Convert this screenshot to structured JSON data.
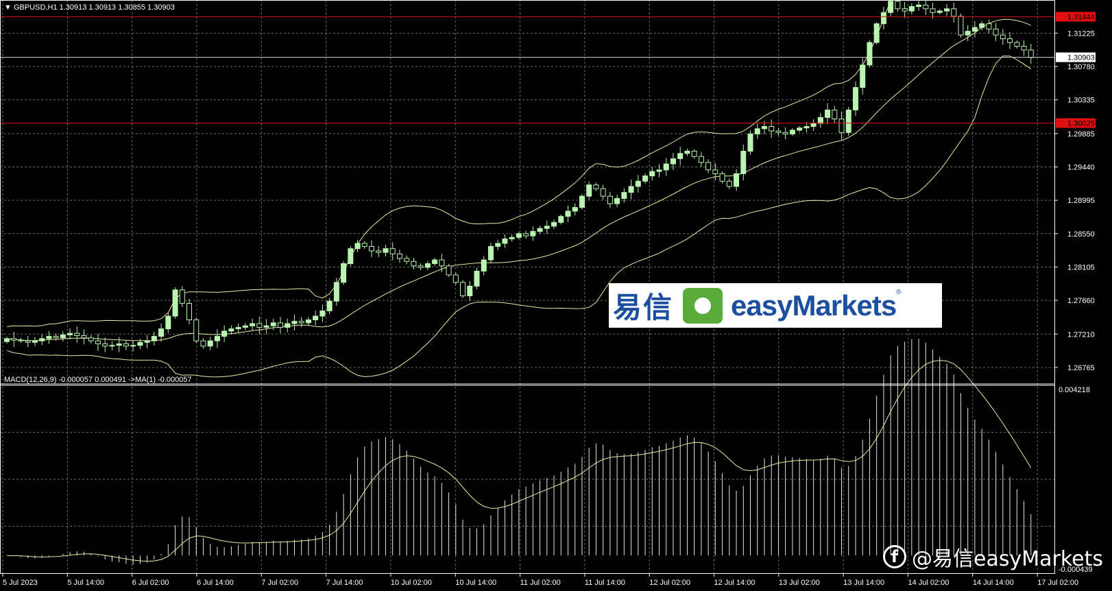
{
  "header": {
    "symbol": "GBPUSD,H1",
    "ohlc": "1.30913 1.30913 1.30855 1.30903",
    "dropdown_icon": "triangle-down-icon"
  },
  "macd_header": "MACD(12,26,9) -0.000057 0.000491  ->MA(1) -0.000057",
  "price_axis": {
    "min": 1.26545,
    "max": 1.31667,
    "ticks": [
      "1.31225",
      "1.30780",
      "1.30335",
      "1.29885",
      "1.29440",
      "1.28995",
      "1.28550",
      "1.28105",
      "1.27660",
      "1.27210",
      "1.26765"
    ],
    "current_price": "1.30903",
    "level_high": "1.31444",
    "level_low": "1.30025"
  },
  "macd_axis": {
    "min": -0.000439,
    "max": 0.004218,
    "top_label": "0.004218",
    "bottom_label": "-0.000439"
  },
  "time_axis": {
    "labels": [
      "5 Jul 2023",
      "5 Jul 14:00",
      "6 Jul 02:00",
      "6 Jul 14:00",
      "7 Jul 02:00",
      "7 Jul 14:00",
      "10 Jul 02:00",
      "10 Jul 14:00",
      "11 Jul 02:00",
      "11 Jul 14:00",
      "12 Jul 02:00",
      "12 Jul 14:00",
      "13 Jul 02:00",
      "13 Jul 14:00",
      "14 Jul 02:00",
      "14 Jul 14:00",
      "17 Jul 02:00"
    ]
  },
  "colors": {
    "background": "#000000",
    "grid": "#6e6e6e",
    "candle": "#b9f5b0",
    "band": "#ecec9e",
    "level_line": "#e01010",
    "macd_bar": "#e8e8e8",
    "signal": "#ecec9e",
    "logo_blue": "#1c4fa0",
    "logo_green": "#5aac3a"
  },
  "chart_data": {
    "type": "candlestick",
    "symbol": "GBPUSD",
    "timeframe": "H1",
    "closes_approx": [
      1.2715,
      1.2713,
      1.2712,
      1.271,
      1.2712,
      1.2715,
      1.2718,
      1.2716,
      1.272,
      1.2722,
      1.2719,
      1.2716,
      1.2712,
      1.2708,
      1.2705,
      1.2706,
      1.2708,
      1.2705,
      1.2706,
      1.271,
      1.2712,
      1.2718,
      1.2728,
      1.2745,
      1.278,
      1.2762,
      1.274,
      1.2712,
      1.2705,
      1.2712,
      1.2718,
      1.2725,
      1.2728,
      1.273,
      1.2732,
      1.2735,
      1.273,
      1.2732,
      1.2736,
      1.273,
      1.2735,
      1.2738,
      1.2736,
      1.274,
      1.2745,
      1.2752,
      1.2765,
      1.279,
      1.2815,
      1.2835,
      1.2842,
      1.2838,
      1.2832,
      1.283,
      1.2835,
      1.2828,
      1.2822,
      1.2818,
      1.2812,
      1.281,
      1.2815,
      1.282,
      1.2812,
      1.28,
      1.279,
      1.2772,
      1.2785,
      1.2805,
      1.282,
      1.2838,
      1.2842,
      1.2848,
      1.285,
      1.2855,
      1.2852,
      1.2858,
      1.2862,
      1.2865,
      1.287,
      1.2878,
      1.2885,
      1.289,
      1.2905,
      1.292,
      1.2915,
      1.2905,
      1.2895,
      1.2902,
      1.291,
      1.2918,
      1.2925,
      1.2932,
      1.2938,
      1.294,
      1.2948,
      1.2955,
      1.2962,
      1.2965,
      1.2958,
      1.295,
      1.294,
      1.2935,
      1.2925,
      1.2918,
      1.2935,
      1.2965,
      1.2988,
      1.2995,
      1.2998,
      1.2992,
      1.299,
      1.2988,
      1.2993,
      1.2996,
      1.2998,
      1.3002,
      1.301,
      1.302,
      1.3008,
      1.299,
      1.302,
      1.305,
      1.308,
      1.311,
      1.3135,
      1.315,
      1.3165,
      1.3155,
      1.3152,
      1.3158,
      1.316,
      1.3155,
      1.315,
      1.3152,
      1.3155,
      1.3145,
      1.312,
      1.3125,
      1.313,
      1.3135,
      1.3128,
      1.312,
      1.3115,
      1.311,
      1.3105,
      1.31,
      1.309
    ],
    "levels": [
      1.31444,
      1.30025
    ],
    "indicators": [
      "Bollinger Bands",
      "MACD(12,26,9)"
    ]
  },
  "brand": {
    "cn": "易信",
    "en": "easyMarkets",
    "reg": "®",
    "watermark": "@易信easyMarkets",
    "watermark_icon": "facebook-icon"
  }
}
